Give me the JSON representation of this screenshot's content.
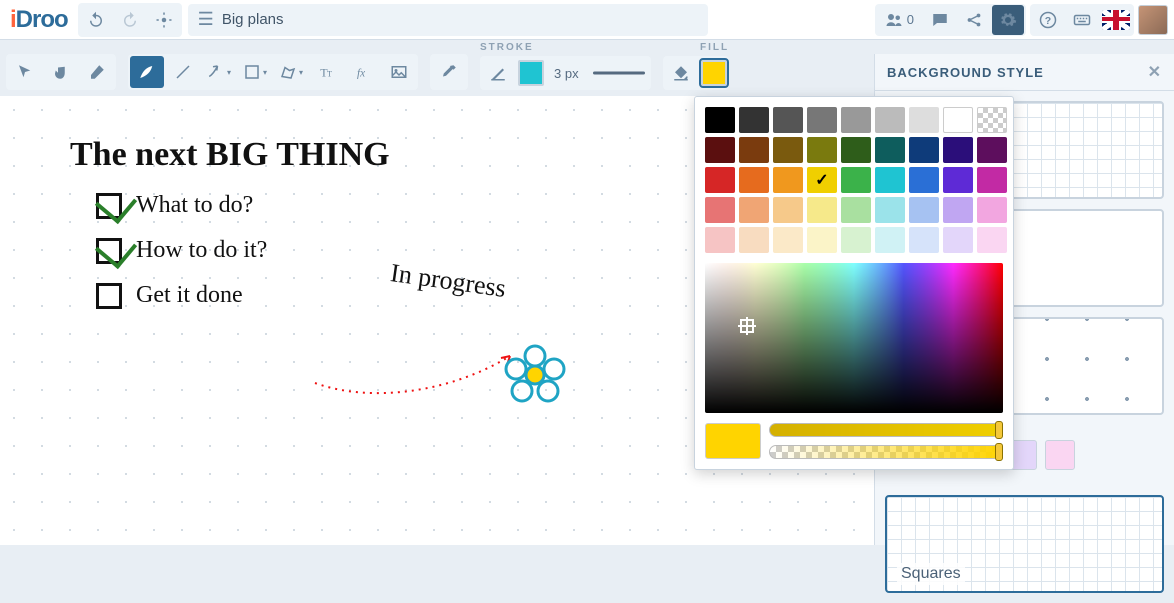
{
  "header": {
    "logo_text": "iDroo",
    "filename": "Big plans",
    "collab_count": "0"
  },
  "sections": {
    "stroke_label": "STROKE",
    "fill_label": "FILL",
    "stroke_width": "3 px"
  },
  "side_panel": {
    "title": "BACKGROUND STYLE",
    "squares_label": "Squares"
  },
  "canvas": {
    "title": "The next BIG THING",
    "items": [
      {
        "checked": true,
        "text": "What to do?"
      },
      {
        "checked": true,
        "text": "How to do it?"
      },
      {
        "checked": false,
        "text": "Get it done"
      }
    ],
    "annotation": "In progress"
  },
  "colors": {
    "stroke_swatch": "#1fc4d2",
    "fill_swatch": "#ffd400",
    "selected_index": 21,
    "preview": "#ffd400",
    "palette": [
      "#000000",
      "#333333",
      "#555555",
      "#777777",
      "#999999",
      "#bbbbbb",
      "#dddddd",
      "#ffffff",
      "transparent",
      "#5b0f0f",
      "#7a3b0e",
      "#7a5a0e",
      "#7a7a0e",
      "#2e5d1a",
      "#0e5d5d",
      "#0e3b7a",
      "#2b0e7a",
      "#5d0e5d",
      "#d62626",
      "#e66b1e",
      "#f0981e",
      "#f0cf00",
      "#3bb24a",
      "#1fc4d2",
      "#2a6fd6",
      "#5e2ad6",
      "#c22aa4",
      "#e77474",
      "#f0a574",
      "#f6c98a",
      "#f6e98a",
      "#a9e0a0",
      "#9be3ea",
      "#a6c2f2",
      "#c0a6f2",
      "#f2a6e0",
      "#f6c4c4",
      "#f8dcc0",
      "#fbe9c8",
      "#fbf4c8",
      "#d7f2d0",
      "#d0f2f5",
      "#d6e3fa",
      "#e3d6fa",
      "#fad6f2"
    ],
    "bg_swatches": [
      "#d7f2d0",
      "#d0f2f5",
      "#d6e3fa",
      "#e3d6fa",
      "#fad6f2"
    ]
  }
}
